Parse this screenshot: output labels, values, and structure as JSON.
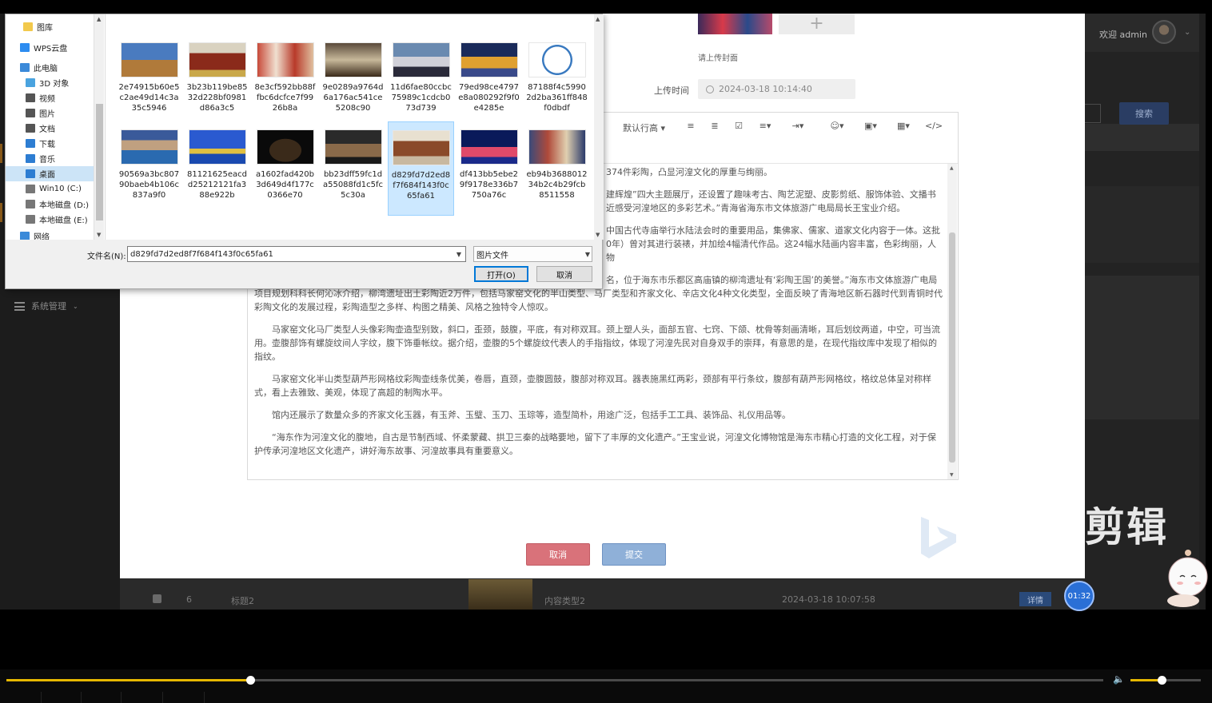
{
  "header": {
    "welcome": "欢迎 admin"
  },
  "sidebar": {
    "menu_system": "系统管理"
  },
  "search": {
    "button_label": "搜索"
  },
  "watermark": {
    "text": "剪辑"
  },
  "panel": {
    "cover_hint": "请上传封面",
    "upload_time_label": "上传时间",
    "upload_time_value": "2024-03-18 10:14:40",
    "cancel_label": "取消",
    "submit_label": "提交"
  },
  "editor": {
    "toolbar": {
      "line_height": "默认行高"
    },
    "paragraphs": [
      "374件彩陶，凸显河湟文化的厚重与绚丽。",
      "建辉煌”四大主题展厅，还设置了趣味考古、陶艺泥塑、皮影剪纸、服饰体验、文播书近感受河湟地区的多彩艺术。”青海省海东市文体旅游广电局局长王宝业介绍。",
      "中国古代寺庙举行水陆法会时的重要用品，集佛家、儒家、道家文化内容于一体。这批0年）曾对其进行装裱，并加绘4幅清代作品。这24幅水陆画内容丰富，色彩绚丽，人物",
      "名，位于海东市乐都区高庙镇的柳湾遗址有‘彩陶王国’的美誉。”海东市文体旅游广电局项目规划科科长何沁冰介绍，柳湾遗址出土彩陶近2万件，包括马家窑文化的半山类型、马厂类型和齐家文化、辛店文化4种文化类型，全面反映了青海地区新石器时代到青铜时代彩陶文化的发展过程，彩陶造型之多样、构图之精美、风格之独特令人惊叹。",
      "马家窑文化马厂类型人头像彩陶壶造型别致，斜口，歪颈，鼓腹，平底，有对称双耳。颈上塑人头，面部五官、七窍、下颌、枕骨等刻画清晰，耳后划纹两道，中空，可当流用。壶腹部饰有螺旋纹间人字纹，腹下饰垂帐纹。据介绍，壶腹的5个螺旋纹代表人的手指指纹，体现了河湟先民对自身双手的崇拜，有意思的是，在现代指纹库中发现了相似的指纹。",
      "马家窑文化半山类型葫芦形网格纹彩陶壶线条优美，卷唇，直颈，壶腹圆鼓，腹部对称双耳。器表施黑红两彩，颈部有平行条纹，腹部有葫芦形网格纹，格纹总体呈对称样式，看上去雅致、美观，体现了高超的制陶水平。",
      "馆内还展示了数量众多的齐家文化玉器，有玉斧、玉璧、玉刀、玉琮等，造型简朴，用途广泛，包括手工工具、装饰品、礼仪用品等。",
      "“海东作为河湟文化的腹地，自古是节制西域、怀柔蒙藏、拱卫三秦的战略要地，留下了丰厚的文化遗产。”王宝业说，河湟文化博物馆是海东市精心打造的文化工程，对于保护传承河湟地区文化遗产，讲好海东故事、河湟故事具有重要意义。"
    ]
  },
  "table_row": {
    "index": "6",
    "title": "标题2",
    "type": "内容类型2",
    "time": "2024-03-18 10:07:58",
    "detail_label": "详情"
  },
  "timer": {
    "value": "01:32"
  },
  "dialog": {
    "nav_items": [
      {
        "label": "图库",
        "icon": "folder-icon",
        "color": "#f2c94c"
      },
      {
        "label": "WPS云盘",
        "icon": "cloud-icon",
        "color": "#2d8cf0"
      },
      {
        "label": "此电脑",
        "icon": "computer-icon",
        "color": "#3b8ad9"
      },
      {
        "label": "3D 对象",
        "icon": "cube-icon",
        "color": "#4aa3df"
      },
      {
        "label": "视频",
        "icon": "video-icon",
        "color": "#555555"
      },
      {
        "label": "图片",
        "icon": "picture-icon",
        "color": "#555555"
      },
      {
        "label": "文档",
        "icon": "document-icon",
        "color": "#555555"
      },
      {
        "label": "下载",
        "icon": "download-icon",
        "color": "#2d7dd2"
      },
      {
        "label": "音乐",
        "icon": "music-icon",
        "color": "#2d7dd2"
      },
      {
        "label": "桌面",
        "icon": "desktop-icon",
        "color": "#2d7dd2"
      },
      {
        "label": "Win10 (C:)",
        "icon": "drive-icon",
        "color": "#777777"
      },
      {
        "label": "本地磁盘 (D:)",
        "icon": "drive-icon",
        "color": "#777777"
      },
      {
        "label": "本地磁盘 (E:)",
        "icon": "drive-icon",
        "color": "#777777"
      },
      {
        "label": "网络",
        "icon": "network-icon",
        "color": "#3b8ad9"
      }
    ],
    "files": [
      {
        "name": "2e74915b60e5c2ae49d14c3a35c5946"
      },
      {
        "name": "3b23b119be8532d228bf0981d86a3c5"
      },
      {
        "name": "8e3cf592bb88ffbc6dcfce7f9926b8a"
      },
      {
        "name": "9e0289a9764d6a176ac541ce5208c90"
      },
      {
        "name": "11d6fae80ccbc75989c1cdcb073d739"
      },
      {
        "name": "79ed98ce4797e8a080292f9f0e4285e"
      },
      {
        "name": "87188f4c59902d2ba361ff848f0dbdf"
      },
      {
        "name": "90569a3bc80790baeb4b106c837a9f0"
      },
      {
        "name": "81121625eacdd25212121fa388e922b"
      },
      {
        "name": "a1602fad420b3d649d4f177c0366e70"
      },
      {
        "name": "bb23dff59fc1da55088fd1c5fc5c30a"
      },
      {
        "name": "d829fd7d2ed8f7f684f143f0c65fa61"
      },
      {
        "name": "df413bb5ebe29f9178e336b7750a76c"
      },
      {
        "name": "eb94b368801234b2c4b29fcb8511558"
      }
    ],
    "selected_file_index": 11,
    "filename_label": "文件名(N):",
    "filename_value": "d829fd7d2ed8f7f684f143f0c65fa61",
    "filetype_value": "图片文件",
    "open_label": "打开(O)",
    "cancel_label": "取消"
  },
  "player": {
    "progress": 0.222,
    "volume": 0.44
  }
}
